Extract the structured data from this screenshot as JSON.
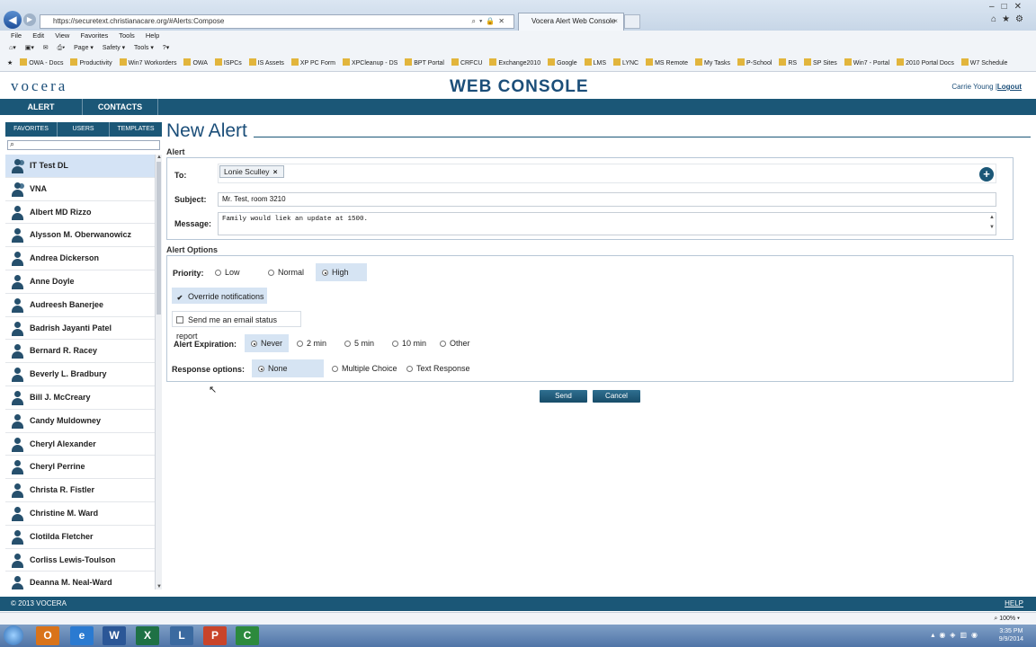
{
  "browser": {
    "url": "https://securetext.christianacare.org/#Alerts:Compose",
    "tab_title": "Vocera Alert Web Console",
    "tab_close": "×",
    "menu": [
      "File",
      "Edit",
      "View",
      "Favorites",
      "Tools",
      "Help"
    ],
    "commands": [
      "Page ▾",
      "Safety ▾",
      "Tools ▾"
    ],
    "favorites": [
      "OWA - Docs",
      "Productivity",
      "Win7 Workorders",
      "OWA",
      "ISPCs",
      "IS Assets",
      "XP PC Form",
      "XPCleanup - DS",
      "BPT Portal",
      "CRFCU",
      "Exchange2010",
      "Google",
      "LMS",
      "LYNC",
      "MS Remote",
      "My Tasks",
      "P-School",
      "RS",
      "SP Sites",
      "Win7 - Portal",
      "2010 Portal Docs",
      "W7 Schedule"
    ],
    "zoom": "100%",
    "status_zoom_label": "100%"
  },
  "app": {
    "logo": "vocera",
    "title": "WEB CONSOLE",
    "user": "Carrie Young",
    "logout": "Logout",
    "separator": "|",
    "nav": [
      "ALERT",
      "CONTACTS"
    ]
  },
  "left_panel": {
    "tabs": [
      "FAVORITES",
      "USERS",
      "TEMPLATES"
    ],
    "contacts": [
      {
        "name": "IT Test DL",
        "group": true,
        "selected": true
      },
      {
        "name": "VNA",
        "group": true
      },
      {
        "name": "Albert MD Rizzo"
      },
      {
        "name": "Alysson M. Oberwanowicz"
      },
      {
        "name": "Andrea Dickerson"
      },
      {
        "name": "Anne Doyle"
      },
      {
        "name": "Audreesh Banerjee"
      },
      {
        "name": "Badrish Jayanti Patel"
      },
      {
        "name": "Bernard R. Racey"
      },
      {
        "name": "Beverly L. Bradbury"
      },
      {
        "name": "Bill J. McCreary"
      },
      {
        "name": "Candy Muldowney"
      },
      {
        "name": "Cheryl Alexander"
      },
      {
        "name": "Cheryl Perrine"
      },
      {
        "name": "Christa R. Fistler"
      },
      {
        "name": "Christine M. Ward"
      },
      {
        "name": "Clotilda Fletcher"
      },
      {
        "name": "Corliss Lewis-Toulson"
      },
      {
        "name": "Deanna M. Neal-Ward"
      }
    ]
  },
  "form": {
    "page_title": "New Alert",
    "alert_section": "Alert",
    "to_label": "To:",
    "recipient": "Lonie Sculley",
    "recipient_remove": "×",
    "subject_label": "Subject:",
    "subject_value": "Mr. Test, room 3210",
    "message_label": "Message:",
    "message_value": "Family would liek an update at 1500.",
    "options_section": "Alert Options",
    "priority_label": "Priority:",
    "priority_options": [
      "Low",
      "Normal",
      "High"
    ],
    "priority_selected": "High",
    "override_label": "Override notifications",
    "override_checked": true,
    "email_label": "Send me an email status report",
    "email_checked": false,
    "expiration_label": "Alert Expiration:",
    "expiration_options": [
      "Never",
      "2 min",
      "5 min",
      "10 min",
      "Other"
    ],
    "expiration_selected": "Never",
    "response_label": "Response options:",
    "response_options": [
      "None",
      "Multiple Choice",
      "Text Response"
    ],
    "response_selected": "None",
    "send": "Send",
    "cancel": "Cancel"
  },
  "footer": {
    "copyright": "© 2013 VOCERA",
    "help": "HELP"
  },
  "taskbar": {
    "time": "3:35 PM",
    "date": "9/9/2014",
    "apps": [
      "O",
      "e",
      "W",
      "X",
      "L",
      "P",
      "C"
    ]
  },
  "colors": {
    "brand": "#1b5777",
    "selected": "#d6e4f3"
  }
}
